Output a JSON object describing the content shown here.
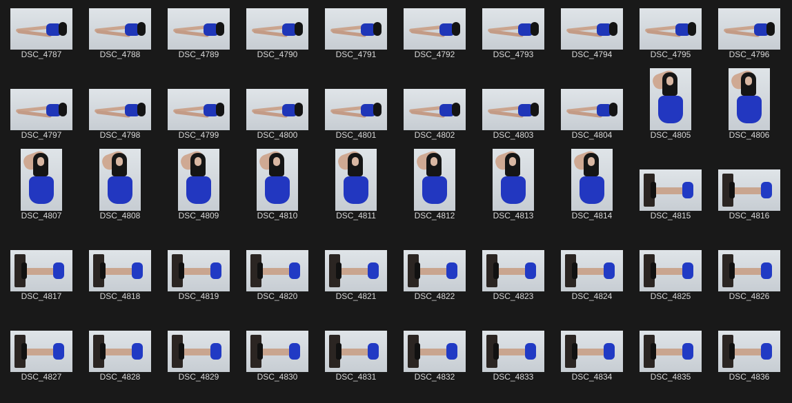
{
  "files": [
    {
      "name": "DSC_4787",
      "orientation": "landscape",
      "scene": "recline"
    },
    {
      "name": "DSC_4788",
      "orientation": "landscape",
      "scene": "recline"
    },
    {
      "name": "DSC_4789",
      "orientation": "landscape",
      "scene": "recline"
    },
    {
      "name": "DSC_4790",
      "orientation": "landscape",
      "scene": "recline"
    },
    {
      "name": "DSC_4791",
      "orientation": "landscape",
      "scene": "recline"
    },
    {
      "name": "DSC_4792",
      "orientation": "landscape",
      "scene": "recline"
    },
    {
      "name": "DSC_4793",
      "orientation": "landscape",
      "scene": "recline"
    },
    {
      "name": "DSC_4794",
      "orientation": "landscape",
      "scene": "recline"
    },
    {
      "name": "DSC_4795",
      "orientation": "landscape",
      "scene": "recline"
    },
    {
      "name": "DSC_4796",
      "orientation": "landscape",
      "scene": "recline"
    },
    {
      "name": "DSC_4797",
      "orientation": "landscape",
      "scene": "recline"
    },
    {
      "name": "DSC_4798",
      "orientation": "landscape",
      "scene": "recline"
    },
    {
      "name": "DSC_4799",
      "orientation": "landscape",
      "scene": "recline"
    },
    {
      "name": "DSC_4800",
      "orientation": "landscape",
      "scene": "recline"
    },
    {
      "name": "DSC_4801",
      "orientation": "landscape",
      "scene": "recline"
    },
    {
      "name": "DSC_4802",
      "orientation": "landscape",
      "scene": "recline"
    },
    {
      "name": "DSC_4803",
      "orientation": "landscape",
      "scene": "recline"
    },
    {
      "name": "DSC_4804",
      "orientation": "landscape",
      "scene": "recline"
    },
    {
      "name": "DSC_4805",
      "orientation": "portrait",
      "scene": "portrait"
    },
    {
      "name": "DSC_4806",
      "orientation": "portrait",
      "scene": "portrait"
    },
    {
      "name": "DSC_4807",
      "orientation": "portrait",
      "scene": "portrait"
    },
    {
      "name": "DSC_4808",
      "orientation": "portrait",
      "scene": "portrait"
    },
    {
      "name": "DSC_4809",
      "orientation": "portrait",
      "scene": "portrait"
    },
    {
      "name": "DSC_4810",
      "orientation": "portrait",
      "scene": "portrait"
    },
    {
      "name": "DSC_4811",
      "orientation": "portrait",
      "scene": "portrait"
    },
    {
      "name": "DSC_4812",
      "orientation": "portrait",
      "scene": "portrait"
    },
    {
      "name": "DSC_4813",
      "orientation": "portrait",
      "scene": "portrait"
    },
    {
      "name": "DSC_4814",
      "orientation": "portrait",
      "scene": "portrait"
    },
    {
      "name": "DSC_4815",
      "orientation": "landscape",
      "scene": "chair"
    },
    {
      "name": "DSC_4816",
      "orientation": "landscape",
      "scene": "chair"
    },
    {
      "name": "DSC_4817",
      "orientation": "landscape",
      "scene": "chair"
    },
    {
      "name": "DSC_4818",
      "orientation": "landscape",
      "scene": "chair"
    },
    {
      "name": "DSC_4819",
      "orientation": "landscape",
      "scene": "chair"
    },
    {
      "name": "DSC_4820",
      "orientation": "landscape",
      "scene": "chair"
    },
    {
      "name": "DSC_4821",
      "orientation": "landscape",
      "scene": "chair"
    },
    {
      "name": "DSC_4822",
      "orientation": "landscape",
      "scene": "chair"
    },
    {
      "name": "DSC_4823",
      "orientation": "landscape",
      "scene": "chair"
    },
    {
      "name": "DSC_4824",
      "orientation": "landscape",
      "scene": "chair"
    },
    {
      "name": "DSC_4825",
      "orientation": "landscape",
      "scene": "chair"
    },
    {
      "name": "DSC_4826",
      "orientation": "landscape",
      "scene": "chair"
    },
    {
      "name": "DSC_4827",
      "orientation": "landscape",
      "scene": "chair"
    },
    {
      "name": "DSC_4828",
      "orientation": "landscape",
      "scene": "chair"
    },
    {
      "name": "DSC_4829",
      "orientation": "landscape",
      "scene": "chair"
    },
    {
      "name": "DSC_4830",
      "orientation": "landscape",
      "scene": "chair"
    },
    {
      "name": "DSC_4831",
      "orientation": "landscape",
      "scene": "chair"
    },
    {
      "name": "DSC_4832",
      "orientation": "landscape",
      "scene": "chair"
    },
    {
      "name": "DSC_4833",
      "orientation": "landscape",
      "scene": "chair"
    },
    {
      "name": "DSC_4834",
      "orientation": "landscape",
      "scene": "chair"
    },
    {
      "name": "DSC_4835",
      "orientation": "landscape",
      "scene": "chair"
    },
    {
      "name": "DSC_4836",
      "orientation": "landscape",
      "scene": "chair"
    }
  ]
}
